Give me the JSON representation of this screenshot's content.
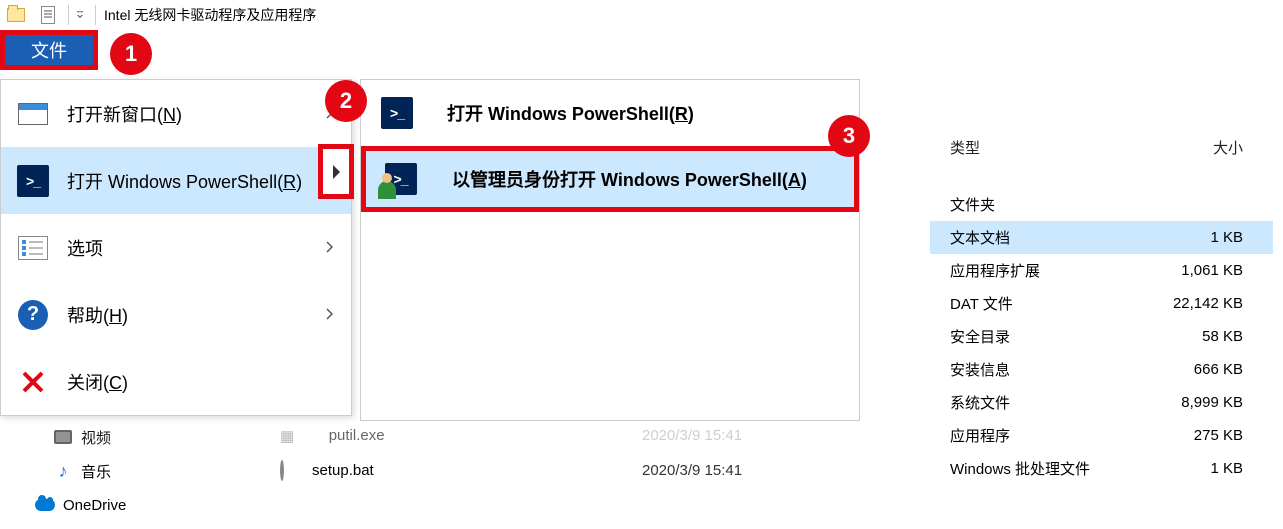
{
  "title": "Intel 无线网卡驱动程序及应用程序",
  "file_tab": "文件",
  "annotations": {
    "a1": "1",
    "a2": "2",
    "a3": "3"
  },
  "menu": {
    "open_new_window": {
      "label": "打开新窗口(",
      "hotkey": "N",
      "suffix": ")"
    },
    "open_ps": {
      "label": "打开 Windows PowerShell(",
      "hotkey": "R",
      "suffix": ")"
    },
    "options": {
      "label": "选项"
    },
    "help": {
      "label": "帮助(",
      "hotkey": "H",
      "suffix": ")"
    },
    "close": {
      "label": "关闭(",
      "hotkey": "C",
      "suffix": ")"
    }
  },
  "submenu": {
    "open_ps": {
      "label": "打开 Windows PowerShell(",
      "hotkey": "R",
      "suffix": ")"
    },
    "open_ps_admin": {
      "label": "以管理员身份打开 Windows PowerShell(",
      "hotkey": "A",
      "suffix": ")"
    }
  },
  "columns": {
    "type": "类型",
    "size": "大小"
  },
  "rows": [
    {
      "type": "文件夹",
      "size": ""
    },
    {
      "type": "文本文档",
      "size": "1 KB",
      "selected": true
    },
    {
      "type": "应用程序扩展",
      "size": "1,061 KB"
    },
    {
      "type": "DAT 文件",
      "size": "22,142 KB"
    },
    {
      "type": "安全目录",
      "size": "58 KB"
    },
    {
      "type": "安装信息",
      "size": "666 KB"
    },
    {
      "type": "系统文件",
      "size": "8,999 KB"
    },
    {
      "type": "应用程序",
      "size": "275 KB"
    },
    {
      "type": "Windows 批处理文件",
      "size": "1 KB"
    }
  ],
  "files": [
    {
      "name": "pnputil.exe",
      "date": "2020/3/9 15:41",
      "partial": true
    },
    {
      "name": "setup.bat",
      "date": "2020/3/9 15:41"
    }
  ],
  "nav": {
    "video": "视频",
    "music": "音乐",
    "onedrive": "OneDrive"
  }
}
